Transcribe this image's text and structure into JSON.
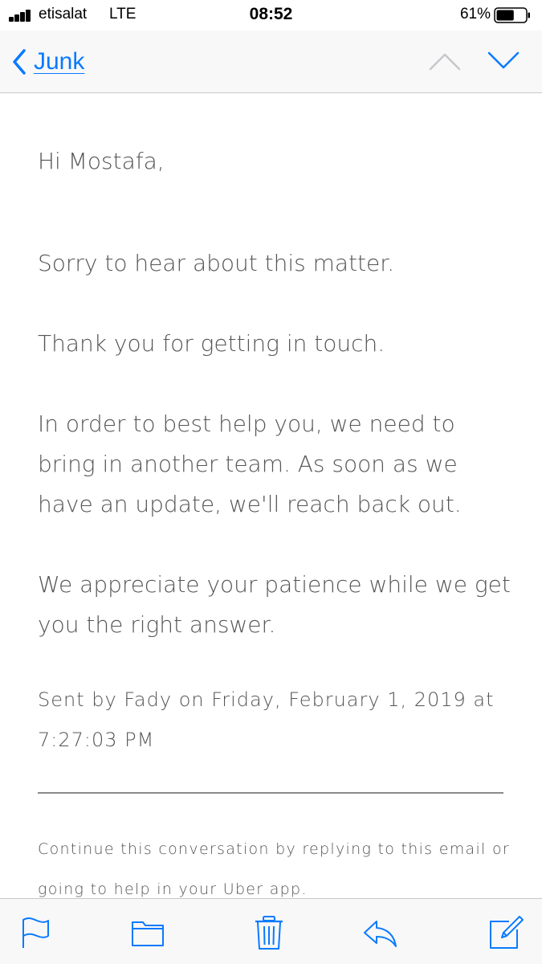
{
  "status_bar": {
    "carrier": "etisalat",
    "network": "LTE",
    "time": "08:52",
    "battery_percent": "61%",
    "battery_level": 0.61
  },
  "nav": {
    "back_label": "Junk",
    "accent_color": "#0a7afe"
  },
  "email": {
    "greeting": "Hi Mostafa,",
    "paragraphs": [
      "Sorry to hear about this matter.",
      "Thank you for getting in touch.",
      "In order to best help you, we need to bring in another team. As soon as we have an update, we'll reach back out.",
      "We appreciate your patience while we get you the right answer."
    ],
    "sent_line": "Sent by Fady on Friday, February 1, 2019 at 7:27:03 PM",
    "footer_note": "Continue this conversation by replying to this email or going to help in your Uber app."
  },
  "toolbar": {
    "icons": [
      "flag-icon",
      "folder-icon",
      "trash-icon",
      "reply-icon",
      "compose-icon"
    ]
  }
}
